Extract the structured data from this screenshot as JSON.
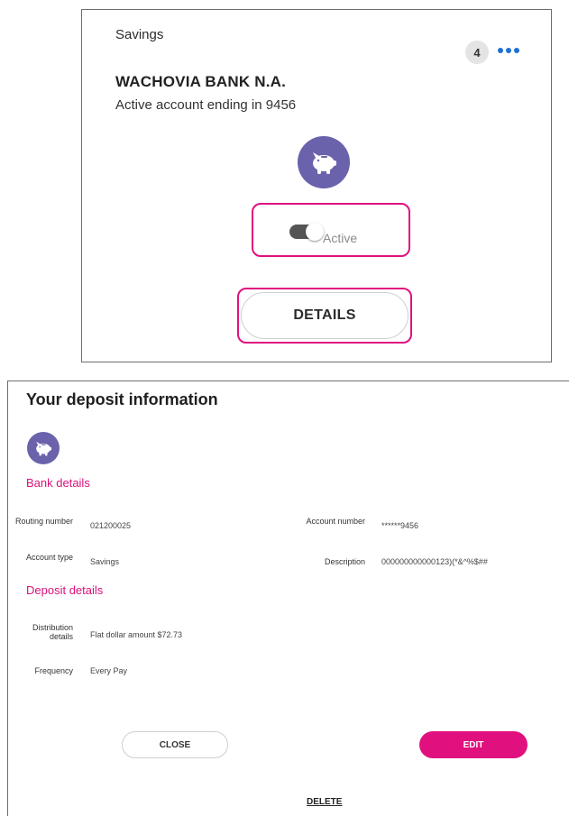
{
  "card": {
    "account_type": "Savings",
    "badge_count": "4",
    "bank_name": "WACHOVIA BANK N.A.",
    "account_line": "Active account ending in 9456",
    "toggle_label": "Active",
    "toggle_on": true,
    "details_label": "DETAILS",
    "icon": "piggy-bank-icon"
  },
  "deposit": {
    "title": "Your deposit information",
    "icon": "piggy-bank-icon",
    "bank_section": "Bank details",
    "routing_label": "Routing number",
    "routing_value": "021200025",
    "account_number_label": "Account number",
    "account_number_value": "******9456",
    "account_type_label": "Account type",
    "account_type_value": "Savings",
    "description_label": "Description",
    "description_value": "000000000000123)(*&^%$##",
    "deposit_section": "Deposit details",
    "distribution_label": "Distribution details",
    "distribution_value": "Flat dollar amount $72.73",
    "frequency_label": "Frequency",
    "frequency_value": "Every Pay",
    "close_label": "CLOSE",
    "edit_label": "EDIT",
    "delete_label": "DELETE"
  },
  "colors": {
    "accent": "#e0117f",
    "icon_bg": "#6a62ab",
    "menu_dots": "#1f6fd1"
  }
}
